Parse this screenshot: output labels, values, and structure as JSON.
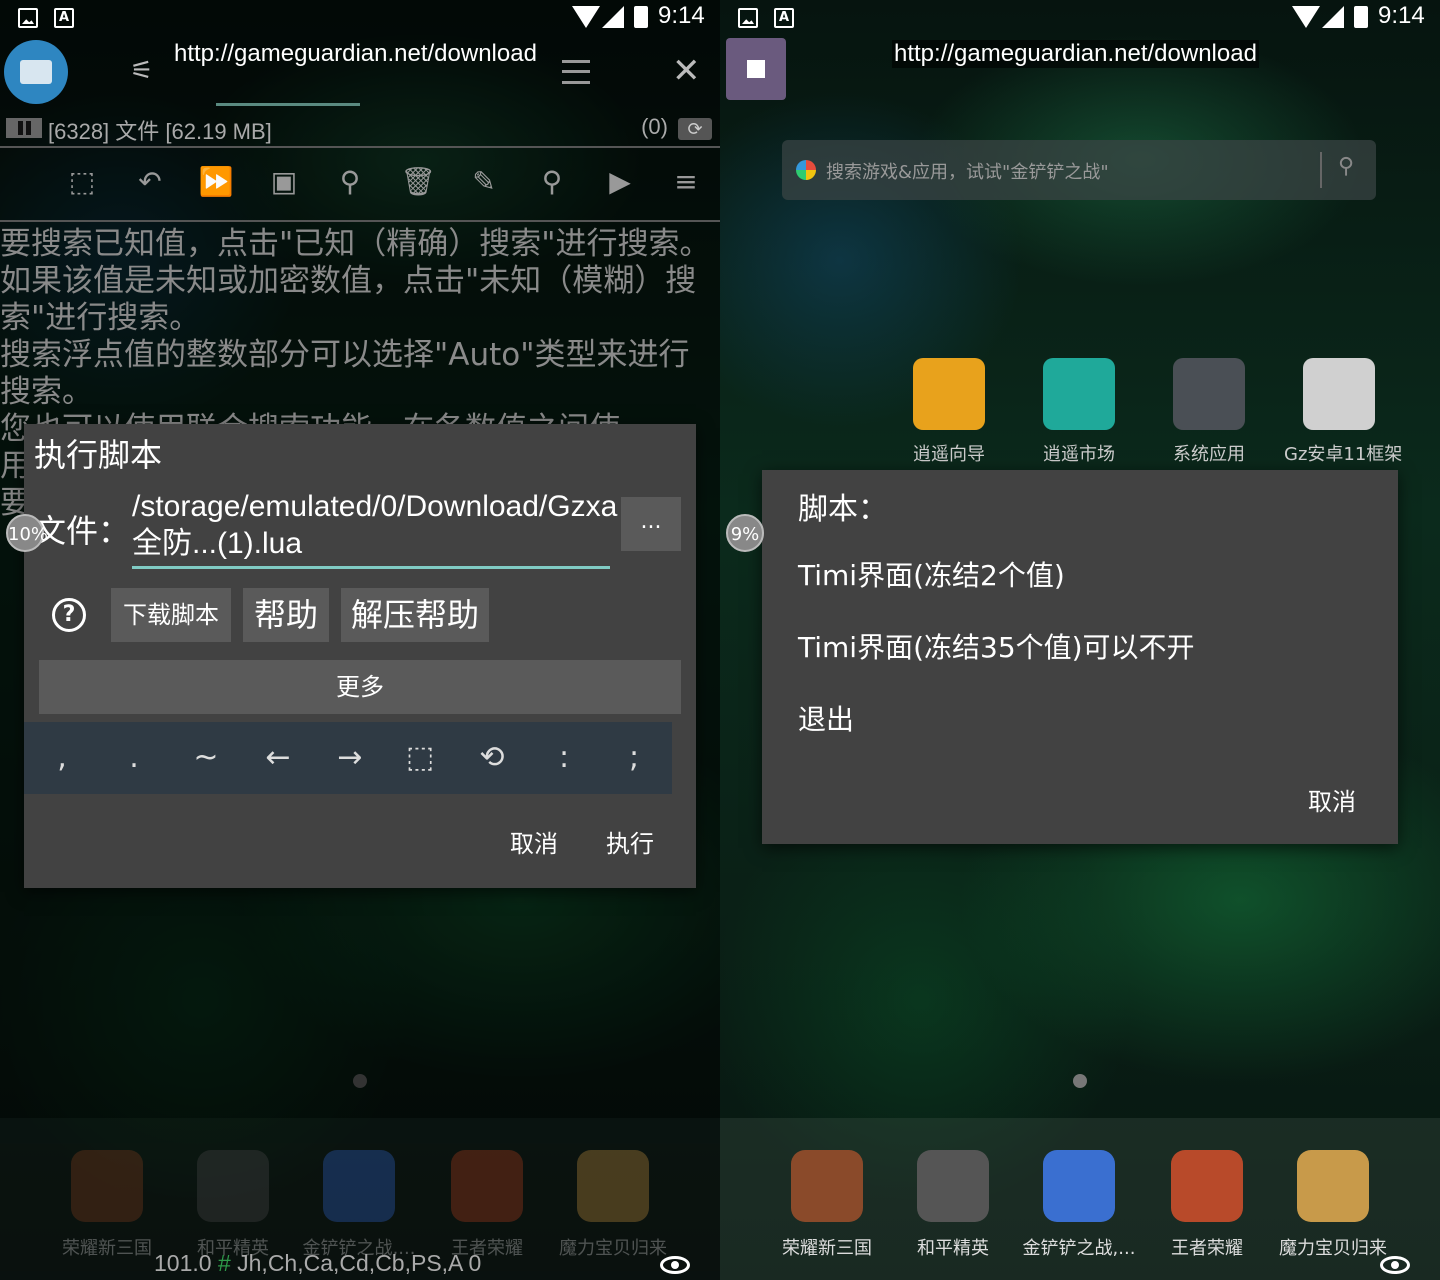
{
  "status_bar": {
    "time": "9:14",
    "notification_icons": [
      "image-icon",
      "a-icon"
    ]
  },
  "left": {
    "url": "http://gameguardian.net/download",
    "process": {
      "label": "[6328] 文件 [62.19 MB]",
      "count": "(0)"
    },
    "help_text": [
      "要搜索已知值，点击\"已知（精确）搜索\"进行搜索。",
      "如果该值是未知或加密数值，点击\"未知（模糊）搜索\"进行搜索。",
      "搜索浮点值的整数部分可以选择\"Auto\"类型来进行搜索。",
      "您也可以使用联合搜索功能，在各数值之间使用\";\"作为",
      "要"
    ],
    "dialog": {
      "title": "执行脚本",
      "file_label": "文件：",
      "file_path": "/storage/emulated/0/Download/Gzxa全防...(1).lua",
      "browse_label": "...",
      "buttons": [
        "下载脚本",
        "帮助",
        "解压帮助"
      ],
      "more_label": "更多",
      "keys": [
        ",",
        ".",
        "~",
        "←",
        "→",
        "⬚",
        "⟲",
        ":",
        ";"
      ],
      "cancel_label": "取消",
      "execute_label": "执行"
    },
    "percent_badge": "10%",
    "footer": {
      "value": "101.0",
      "hash": "#",
      "regions": "Jh,Ch,Ca,Cd,Cb,PS,A 0"
    }
  },
  "right": {
    "url": "http://gameguardian.net/download",
    "search_placeholder": "搜索游戏&应用，试试\"金铲铲之战\"",
    "home_apps": [
      {
        "label": "逍遥向导",
        "color": "#e8a21c"
      },
      {
        "label": "逍遥市场",
        "color": "#1fa99a"
      },
      {
        "label": "系统应用",
        "color": "#4a4f55"
      },
      {
        "label": "Gz安卓11框架",
        "color": "#d0d0d0"
      }
    ],
    "dialog": {
      "title": "脚本：",
      "items": [
        "Timi界面(冻结2个值)",
        "Timi界面(冻结35个值)可以不开",
        "退出"
      ],
      "cancel_label": "取消"
    },
    "percent_badge": "9%"
  },
  "dock_apps": [
    {
      "label": "荣耀新三国",
      "color": "#8a4a2a"
    },
    {
      "label": "和平精英",
      "color": "#555555"
    },
    {
      "label": "金铲铲之战,...",
      "color": "#3a6fd0"
    },
    {
      "label": "王者荣耀",
      "color": "#b84a2a"
    },
    {
      "label": "魔力宝贝归来",
      "color": "#c89a4a"
    }
  ]
}
